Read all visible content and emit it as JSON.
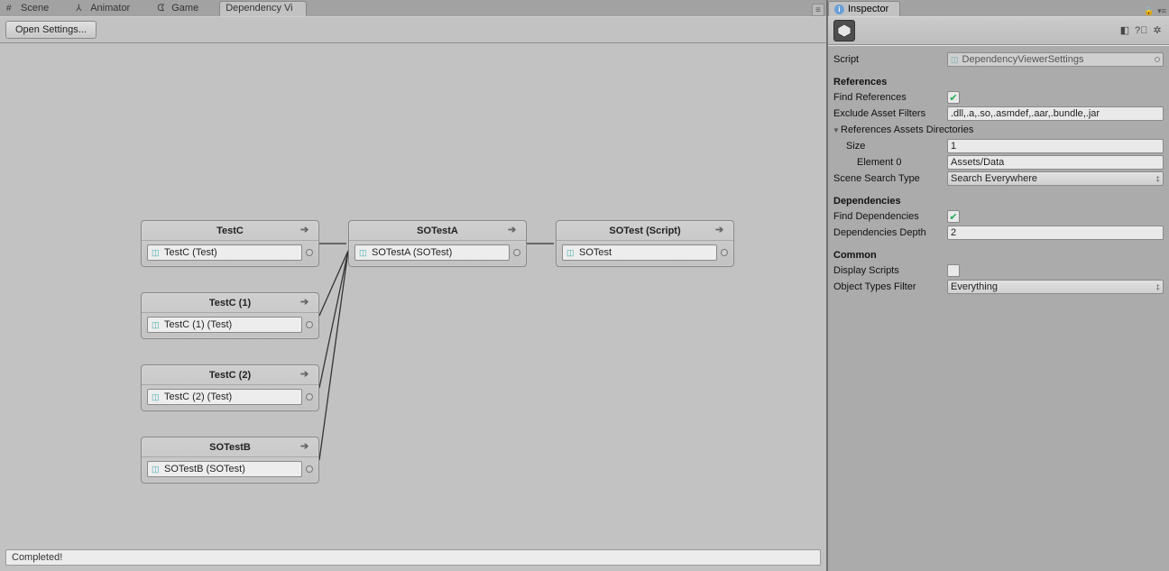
{
  "tabs": {
    "scene": "Scene",
    "animator": "Animator",
    "game": "Game",
    "dependency": "Dependency Vi"
  },
  "toolbar": {
    "open_settings": "Open Settings..."
  },
  "status": "Completed!",
  "nodes": {
    "testc": {
      "title": "TestC",
      "field": "TestC (Test)"
    },
    "testc1": {
      "title": "TestC (1)",
      "field": "TestC (1) (Test)"
    },
    "testc2": {
      "title": "TestC (2)",
      "field": "TestC (2) (Test)"
    },
    "sotestb": {
      "title": "SOTestB",
      "field": "SOTestB (SOTest)"
    },
    "sotesta": {
      "title": "SOTestA",
      "field": "SOTestA (SOTest)"
    },
    "sotest": {
      "title": "SOTest (Script)",
      "field": "SOTest"
    }
  },
  "inspector": {
    "tab": "Inspector",
    "script_label": "Script",
    "script_value": "DependencyViewerSettings",
    "references_title": "References",
    "find_references_label": "Find References",
    "find_references_checked": true,
    "exclude_filters_label": "Exclude Asset Filters",
    "exclude_filters_value": ".dll,.a,.so,.asmdef,.aar,.bundle,.jar",
    "ref_dirs_label": "References Assets Directories",
    "size_label": "Size",
    "size_value": "1",
    "element0_label": "Element 0",
    "element0_value": "Assets/Data",
    "scene_search_label": "Scene Search Type",
    "scene_search_value": "Search Everywhere",
    "dependencies_title": "Dependencies",
    "find_deps_label": "Find Dependencies",
    "find_deps_checked": true,
    "deps_depth_label": "Dependencies Depth",
    "deps_depth_value": "2",
    "common_title": "Common",
    "display_scripts_label": "Display Scripts",
    "display_scripts_checked": false,
    "obj_types_label": "Object Types Filter",
    "obj_types_value": "Everything"
  }
}
